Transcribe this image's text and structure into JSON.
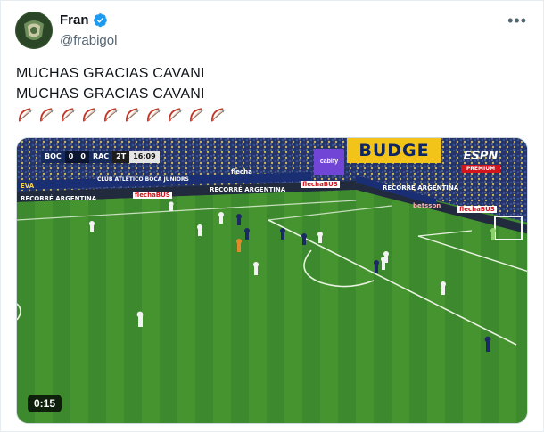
{
  "author": {
    "display_name": "Fran",
    "handle": "@frabigol",
    "verified": true,
    "avatar_icon": "crest-avatar-icon",
    "verified_color": "#1d9bf0"
  },
  "menu": {
    "more_glyph": "•••"
  },
  "tweet": {
    "lines": [
      "MUCHAS GRACIAS CAVANI",
      "MUCHAS GRACIAS CAVANI"
    ],
    "emoji_icon": "bow-and-arrow-icon",
    "emoji_count": 10
  },
  "video": {
    "duration": "0:15",
    "scorebug": {
      "home": "BOC",
      "home_score": "0",
      "away_score": "0",
      "away": "RAC",
      "period": "2T",
      "clock": "16:09"
    },
    "broadcaster": {
      "logo": "ESPN",
      "sub": "PREMIUM"
    },
    "ads": {
      "sponsor_main": "BUDGE",
      "sponsor_side": "cabify",
      "boards": [
        "EVA",
        "flecha",
        "CLUB ATLÉTICO BOCA JUNIORS",
        "RECORRÉ ARGENTINA",
        "flechaBUS",
        "RECORRÉ ARGENTINA",
        "flechaBUS",
        "RECORRÉ ARGENTINA",
        "betsson",
        "flechaBUS"
      ]
    }
  }
}
